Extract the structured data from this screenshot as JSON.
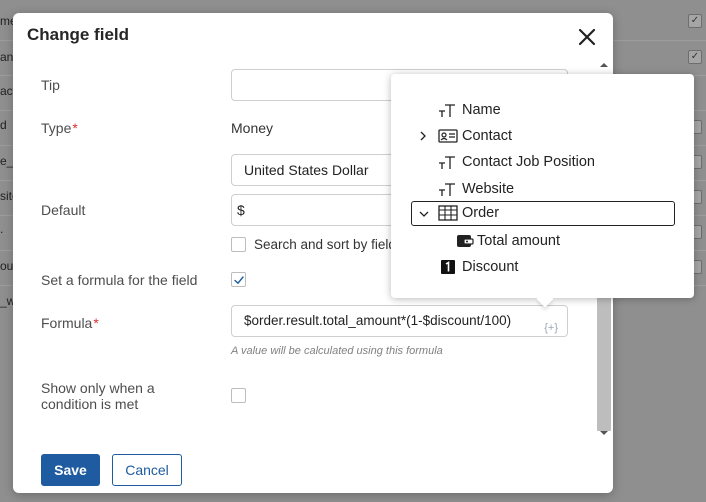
{
  "background": {
    "fragments": [
      "me",
      "ant",
      "act",
      "d",
      "e_",
      "site",
      ".",
      "ount",
      "_w"
    ]
  },
  "dialog": {
    "title": "Change field",
    "fields": {
      "tip": {
        "label": "Tip",
        "value": ""
      },
      "type": {
        "label": "Type",
        "value": "Money",
        "currency": "United States Dollar"
      },
      "default": {
        "label": "Default",
        "value": "$",
        "search_sort_label": "Search and sort by field"
      },
      "set_formula": {
        "label": "Set a formula for the field",
        "checked": true
      },
      "formula": {
        "label": "Formula",
        "value": "$order.result.total_amount*(1-$discount/100)",
        "insert_label": "{+}",
        "hint": "A value will be calculated using this formula"
      },
      "show_condition": {
        "label_line1": "Show only when a",
        "label_line2": "condition is met",
        "checked": false
      }
    },
    "buttons": {
      "save": "Save",
      "cancel": "Cancel"
    }
  },
  "tree_popup": {
    "items": [
      {
        "label": "Name",
        "icon": "text-field-icon"
      },
      {
        "label": "Contact",
        "icon": "contact-card-icon",
        "expandable": true,
        "expanded": false
      },
      {
        "label": "Contact Job Position",
        "icon": "text-field-icon"
      },
      {
        "label": "Website",
        "icon": "text-field-icon"
      },
      {
        "label": "Order",
        "icon": "table-icon",
        "expandable": true,
        "expanded": true,
        "selected": true
      },
      {
        "label": "Total amount",
        "icon": "wallet-icon",
        "child": true
      },
      {
        "label": "Discount",
        "icon": "number-icon"
      }
    ]
  },
  "colors": {
    "primary": "#1e5ba0",
    "required": "#d93030"
  }
}
